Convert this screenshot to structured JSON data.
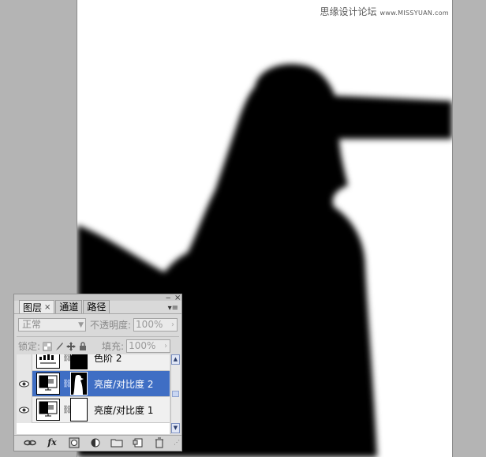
{
  "watermark": {
    "text": "思缘设计论坛",
    "url": "www.MISSYUAN.com"
  },
  "panel": {
    "tabs": [
      {
        "label": "图层",
        "close": "×",
        "active": true
      },
      {
        "label": "通道",
        "active": false
      },
      {
        "label": "路径",
        "active": false
      }
    ],
    "window_buttons": {
      "minimize": "‒",
      "close": "×",
      "menu": "▾≡"
    },
    "blend_mode": "正常",
    "opacity_label": "不透明度:",
    "opacity_value": "100%",
    "lock_label": "锁定:",
    "fill_label": "填充:",
    "fill_value": "100%",
    "layers": [
      {
        "name": "色阶 2",
        "selected": false,
        "visible": false
      },
      {
        "name": "亮度/对比度 2",
        "selected": true,
        "visible": true
      },
      {
        "name": "亮度/对比度 1",
        "selected": false,
        "visible": true
      }
    ],
    "bottom_icons": [
      "link-icon",
      "fx-icon",
      "mask-icon",
      "adjustment-icon",
      "folder-icon",
      "new-layer-icon",
      "trash-icon"
    ],
    "fx_label": "fx"
  },
  "colors": {
    "canvas_bg": "#b4b4b4",
    "selection": "#3f6ec4"
  }
}
